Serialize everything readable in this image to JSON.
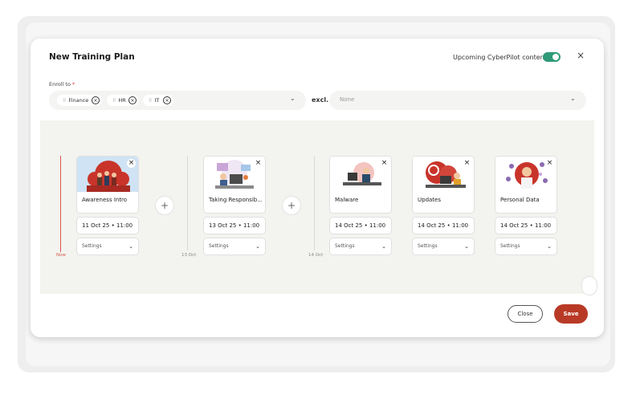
{
  "header": {
    "title": "New Training Plan",
    "upcoming_label": "Upcoming CyberPilot content",
    "upcoming_enabled": true,
    "close_icon": "×"
  },
  "enroll": {
    "label": "Enroll to",
    "required_mark": "*",
    "chips": [
      "Finance",
      "HR",
      "IT"
    ],
    "remove_icon": "×",
    "chevron": "⌄"
  },
  "exclude": {
    "label": "excl.",
    "placeholder": "None",
    "chevron": "⌄"
  },
  "timeline": {
    "markers": [
      "Now",
      "13 Oct",
      "14 Oct"
    ],
    "add_icon": "+",
    "courses": [
      {
        "name": "Awareness Intro",
        "date": "11 Oct 25 • 11:00",
        "settings": "Settings"
      },
      {
        "name": "Taking Responsib...",
        "date": "13 Oct 25 • 11:00",
        "settings": "Settings"
      },
      {
        "name": "Malware",
        "date": "14 Oct 25 • 11:00",
        "settings": "Settings"
      },
      {
        "name": "Updates",
        "date": "14 Oct 25 • 11:00",
        "settings": "Settings"
      },
      {
        "name": "Personal Data",
        "date": "14 Oct 25 • 11:00",
        "settings": "Settings"
      }
    ],
    "remove_icon": "×",
    "settings_chevron": "⌄"
  },
  "footer": {
    "close_label": "Close",
    "save_label": "Save"
  },
  "colors": {
    "accent": "#b83a26",
    "toggle": "#2e9a78",
    "timeline_now": "#d9594c"
  }
}
